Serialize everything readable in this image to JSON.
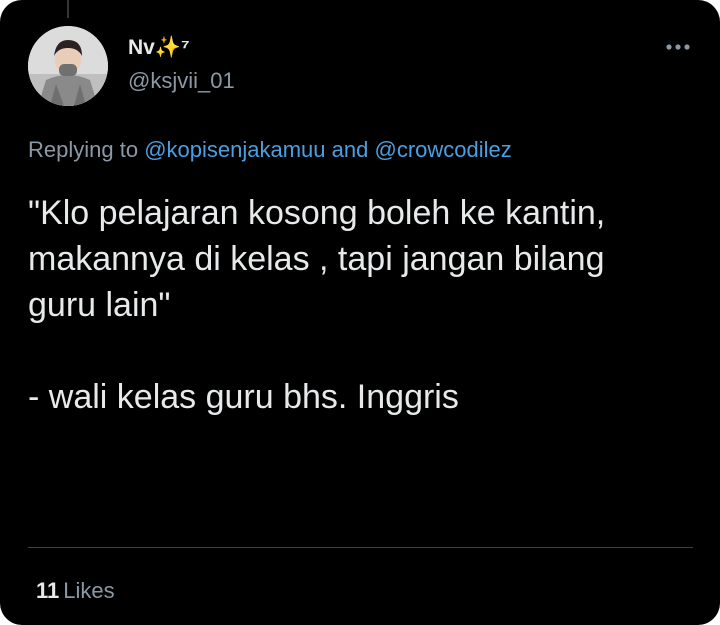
{
  "author": {
    "display_name": "Nv✨⁷",
    "handle": "@ksjvii_01"
  },
  "reply": {
    "prefix": "Replying to",
    "mention_1": "@kopisenjakamuu",
    "conjunction": "and",
    "mention_2": "@crowcodilez"
  },
  "tweet": {
    "line_1": "\"Klo pelajaran kosong boleh ke kantin,",
    "line_2": "makannya di kelas , tapi jangan bilang",
    "line_3": "guru lain\"",
    "line_4": "- wali kelas guru bhs. Inggris"
  },
  "stats": {
    "likes_count": "11",
    "likes_label": "Likes"
  },
  "icons": {
    "more": "more-horizontal-icon"
  },
  "colors": {
    "background": "#000000",
    "primary_text": "#e7e9ea",
    "secondary_text": "#8b98a5",
    "link": "#4b9fe1",
    "divider": "#3e4144"
  }
}
